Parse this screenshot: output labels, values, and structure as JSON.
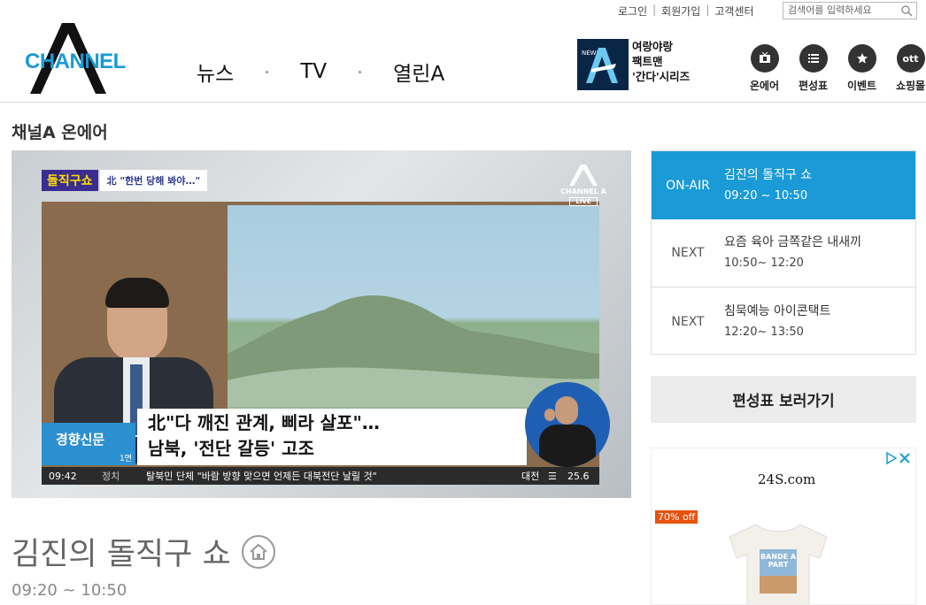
{
  "util": {
    "login": "로그인",
    "signup": "회원가입",
    "support": "고객센터",
    "search_placeholder": "검색어를 입력하세요"
  },
  "logo": {
    "text": "CHANNEL"
  },
  "gnb": [
    "뉴스",
    "TV",
    "열린A"
  ],
  "promo": {
    "badge": "NEWS",
    "lines": [
      "여랑야랑",
      "팩트맨",
      "'간다'시리즈"
    ]
  },
  "quick": [
    {
      "label": "온에어",
      "icon": "tv-icon"
    },
    {
      "label": "편성표",
      "icon": "list-icon"
    },
    {
      "label": "이벤트",
      "icon": "star-icon"
    },
    {
      "label": "쇼핑몰",
      "icon": "ott-icon",
      "icon_text": "ott"
    }
  ],
  "section_title": "채널A 온에어",
  "player": {
    "show_logo": "돌직구쇼",
    "topic": "北 \"한번 당해 봐야…\"",
    "channel_mark": "CHANNEL A",
    "live": "LIVE",
    "headline1": "北\"다 깨진 관계, 삐라 살포\"…",
    "headline2": "남북, '전단 갈등' 고조",
    "paper": "경향신문",
    "paper_page": "1면",
    "time": "09:42",
    "category": "정치",
    "ticker": "탈북민 단체 \"바람 방향 맞으면 언제든 대북전단 날릴 것\"",
    "weather_city": "대전",
    "weather_temp": "25.6"
  },
  "show": {
    "title": "김진의 돌직구 쇼",
    "time": "09:20 ~ 10:50"
  },
  "schedule": [
    {
      "state": "ON-AIR",
      "title": "김진의 돌직구 쇼",
      "time": "09:20 ~ 10:50",
      "active": true
    },
    {
      "state": "NEXT",
      "title": "요즘 육아 금쪽같은 내새끼",
      "time": "10:50~ 12:20",
      "active": false
    },
    {
      "state": "NEXT",
      "title": "침묵예능 아이콘택트",
      "time": "12:20~ 13:50",
      "active": false
    }
  ],
  "goto_schedule": "편성표 보러가기",
  "ad": {
    "brand": "24S.com",
    "badge": "70% off",
    "shirt_text": "BANDE A PART"
  },
  "colors": {
    "accent": "#1a9ad6",
    "logo_blue": "#1a9ad6"
  }
}
